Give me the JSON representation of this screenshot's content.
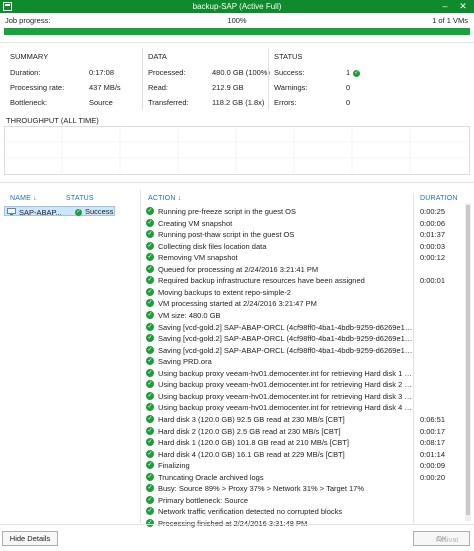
{
  "window": {
    "title": "backup-SAP (Active Full)"
  },
  "progress": {
    "label": "Job progress:",
    "percent_text": "100%",
    "count_text": "1 of 1 VMs",
    "fraction": 1.0
  },
  "summary": {
    "title": "SUMMARY",
    "rows": [
      {
        "label": "Duration:",
        "value": "0:17:08"
      },
      {
        "label": "Processing rate:",
        "value": "437 MB/s"
      },
      {
        "label": "Bottleneck:",
        "value": "Source"
      }
    ]
  },
  "data": {
    "title": "DATA",
    "rows": [
      {
        "label": "Processed:",
        "value": "480.0 GB (100%)"
      },
      {
        "label": "Read:",
        "value": "212.9 GB"
      },
      {
        "label": "Transferred:",
        "value": "118.2 GB (1.8x)"
      }
    ]
  },
  "status": {
    "title": "STATUS",
    "rows": [
      {
        "label": "Success:",
        "value": "1"
      },
      {
        "label": "Warnings:",
        "value": "0"
      },
      {
        "label": "Errors:",
        "value": "0"
      }
    ]
  },
  "throughput": {
    "title": "THROUGHPUT (ALL TIME)"
  },
  "vms": {
    "col_name": "NAME",
    "col_status": "STATUS",
    "items": [
      {
        "name": "SAP-ABAP...",
        "status": "Success"
      }
    ]
  },
  "actions": {
    "col_action": "ACTION",
    "col_duration": "DURATION",
    "items": [
      {
        "text": "Running pre-freeze script in the guest OS",
        "duration": "0:00:25"
      },
      {
        "text": "Creating VM snapshot",
        "duration": "0:00:06"
      },
      {
        "text": "Running post-thaw script in the guest OS",
        "duration": "0:01:37"
      },
      {
        "text": "Collecting disk files location data",
        "duration": "0:00:03"
      },
      {
        "text": "Removing VM snapshot",
        "duration": "0:00:12"
      },
      {
        "text": "Queued for processing at 2/24/2016 3:21:41 PM",
        "duration": ""
      },
      {
        "text": "Required backup infrastructure resources have been assigned",
        "duration": "0:00:01"
      },
      {
        "text": "Moving backups to extent repo-simple-2",
        "duration": ""
      },
      {
        "text": "VM processing started at 2/24/2016 3:21:47 PM",
        "duration": ""
      },
      {
        "text": "VM size: 480.0 GB",
        "duration": ""
      },
      {
        "text": "Saving [vcd-gold.2] SAP-ABAP-ORCL (4cf98ff0-4ba1-4bdb-9259-d6269e1940cc)/S...",
        "duration": ""
      },
      {
        "text": "Saving [vcd-gold.2] SAP-ABAP-ORCL (4cf98ff0-4ba1-4bdb-9259-d6269e1940cc)/S...",
        "duration": ""
      },
      {
        "text": "Saving [vcd-gold.2] SAP-ABAP-ORCL (4cf98ff0-4ba1-4bdb-9259-d6269e1940cc)/S...",
        "duration": ""
      },
      {
        "text": "Saving PRD.ora",
        "duration": ""
      },
      {
        "text": "Using backup proxy veeam-hv01.democenter.int for retrieving Hard disk 1 data fr...",
        "duration": ""
      },
      {
        "text": "Using backup proxy veeam-hv01.democenter.int for retrieving Hard disk 2 data fr...",
        "duration": ""
      },
      {
        "text": "Using backup proxy veeam-hv01.democenter.int for retrieving Hard disk 3 data fr...",
        "duration": ""
      },
      {
        "text": "Using backup proxy veeam-hv01.democenter.int for retrieving Hard disk 4 data fr...",
        "duration": ""
      },
      {
        "text": "Hard disk 3 (120.0 GB) 92.5 GB read at 230 MB/s [CBT]",
        "duration": "0:06:51"
      },
      {
        "text": "Hard disk 2 (120.0 GB) 2.5 GB read at 230 MB/s [CBT]",
        "duration": "0:00:17"
      },
      {
        "text": "Hard disk 1 (120.0 GB) 101.8 GB read at 210 MB/s [CBT]",
        "duration": "0:08:17"
      },
      {
        "text": "Hard disk 4 (120.0 GB) 16.1 GB read at 229 MB/s [CBT]",
        "duration": "0:01:14"
      },
      {
        "text": "Finalizing",
        "duration": "0:00:09"
      },
      {
        "text": "Truncating Oracle archived logs",
        "duration": "0:00:20"
      },
      {
        "text": "Busy: Source 89% > Proxy 37% > Network 31% > Target 17%",
        "duration": ""
      },
      {
        "text": "Primary bottleneck: Source",
        "duration": ""
      },
      {
        "text": "Network traffic verification detected no corrupted blocks",
        "duration": ""
      },
      {
        "text": "Processing finished at 2/24/2016 3:31:48 PM",
        "duration": ""
      }
    ]
  },
  "footer": {
    "hide_details_label": "Hide Details",
    "ok_label": "OK",
    "watermark": "Activat"
  },
  "colors": {
    "accent_green": "#0f8a2c",
    "success_green": "#1f9d3a",
    "header_blue": "#1f6fba",
    "selection_blue": "#cfe5fb"
  }
}
